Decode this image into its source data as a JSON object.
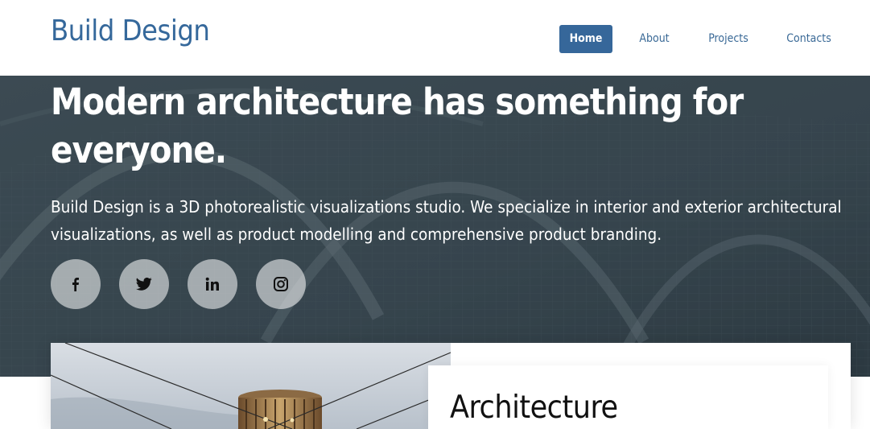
{
  "header": {
    "logo": "Build Design",
    "nav": [
      {
        "label": "Home",
        "active": true
      },
      {
        "label": "About",
        "active": false
      },
      {
        "label": "Projects",
        "active": false
      },
      {
        "label": "Contacts",
        "active": false
      }
    ]
  },
  "hero": {
    "title": "Modern architecture has something for everyone.",
    "description": "Build Design is a 3D photorealistic visualizations studio. We specialize in interior and exterior architectural visualizations, as well as product modelling and comprehensive product branding.",
    "social": [
      {
        "icon": "facebook-icon",
        "glyph": "f"
      },
      {
        "icon": "twitter-icon",
        "glyph": ""
      },
      {
        "icon": "linkedin-icon",
        "glyph": "in"
      },
      {
        "icon": "instagram-icon",
        "glyph": ""
      }
    ]
  },
  "feature": {
    "title": "Architecture"
  },
  "colors": {
    "brand": "#35689b",
    "hero_overlay": "#3f4f59"
  }
}
